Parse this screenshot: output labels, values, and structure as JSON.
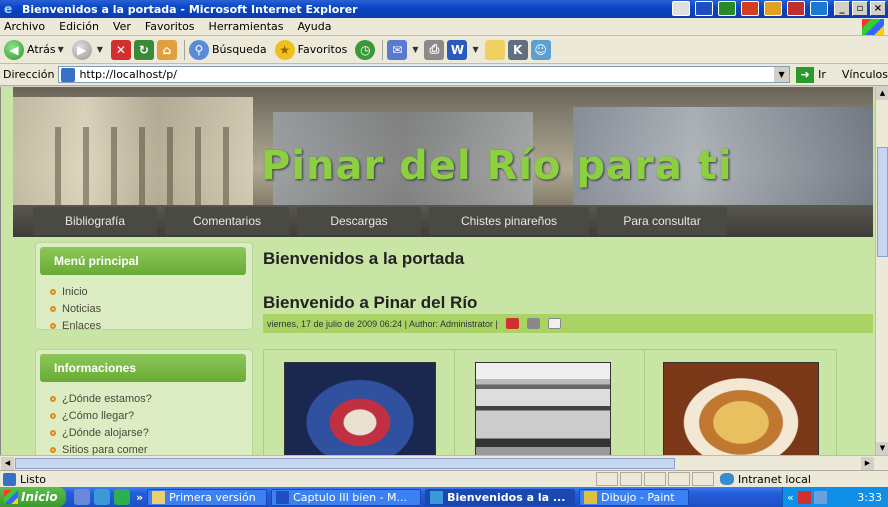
{
  "window": {
    "title": "Bienvenidos a la portada - Microsoft Internet Explorer"
  },
  "menu": [
    "Archivo",
    "Edición",
    "Ver",
    "Favoritos",
    "Herramientas",
    "Ayuda"
  ],
  "toolbar": {
    "back": "Atrás",
    "search": "Búsqueda",
    "favorites": "Favoritos"
  },
  "address": {
    "label": "Dirección",
    "url": "http://localhost/p/",
    "go": "Ir",
    "links": "Vínculos"
  },
  "site": {
    "title": "Pinar del Río para ti",
    "nav": [
      "Bibliografía",
      "Comentarios",
      "Descargas",
      "Chistes pinareños",
      "Para consultar"
    ],
    "menu_module": {
      "heading": "Menú principal",
      "items": [
        "Inicio",
        "Noticias",
        "Enlaces"
      ]
    },
    "info_module": {
      "heading": "Informaciones",
      "items": [
        "¿Dónde estamos?",
        "¿Cómo llegar?",
        "¿Dónde alojarse?",
        "Sitios para comer"
      ]
    },
    "page_heading": "Bienvenidos a la portada",
    "article": {
      "title": "Bienvenido a Pinar del Río",
      "meta": "viernes, 17 de julio de 2009 06:24 | Author: Administrator |"
    }
  },
  "status": {
    "text": "Listo",
    "zone": "Intranet local"
  },
  "taskbar": {
    "start": "Inicio",
    "tasks": [
      "Primera versión",
      "Captulo III bien - M...",
      "Bienvenidos a la ...",
      "Dibujo - Paint"
    ],
    "clock": "3:33"
  }
}
